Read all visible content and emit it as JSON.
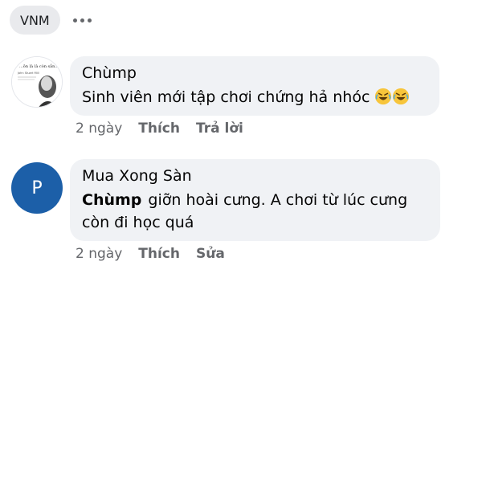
{
  "header": {
    "chip_label": "VNM",
    "more_icon": "more-horizontal-icon"
  },
  "comments": [
    {
      "author": "Chùmp",
      "avatar": {
        "type": "photo",
        "caption_line1": "...ôn là là còn sẵn...",
        "caption_line2": "John Stuart Mill"
      },
      "text": "Sinh viên mới tập chơi chứng hả nhóc",
      "emoji": "rolling-on-floor-laughing-emoji",
      "time": "2 ngày",
      "like_label": "Thích",
      "reply_label": "Trả lời"
    },
    {
      "author": "Mua Xong Sàn",
      "avatar": {
        "type": "letter",
        "letter": "P",
        "color": "#1c5fa8"
      },
      "mention": "Chùmp",
      "text_line1": "giỡn hoài cưng. A chơi từ lúc cưng",
      "text_line2": "còn đi học quá",
      "time": "2 ngày",
      "like_label": "Thích",
      "edit_label": "Sửa"
    }
  ]
}
